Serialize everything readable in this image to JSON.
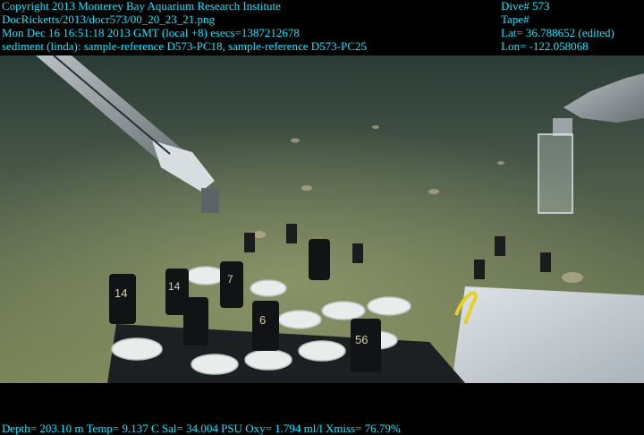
{
  "overlay": {
    "top_left": [
      "Copyright 2013 Monterey Bay Aquarium Research Institute",
      "DocRicketts/2013/docr573/00_20_23_21.png",
      "Mon Dec 16 16:51:18 2013 GMT (local +8)  esecs=1387212678",
      "sediment (linda): sample-reference D573-PC18, sample-reference D573-PC25"
    ],
    "top_right": [
      "Dive# 573",
      "Tape#",
      "Lat= 36.788652 (edited)",
      "Lon= -122.058068"
    ],
    "bottom": "Depth= 203.10 m  Temp= 9.137 C  Sal= 34.004 PSU  Oxy= 1.794 ml/l  Xmiss= 76.79%"
  },
  "scene": {
    "description_icons": [
      "robotic-arm-icon",
      "sediment-core-tube-icon"
    ],
    "tube_labels": [
      "14",
      "14",
      "7",
      "6",
      "56"
    ],
    "colors": {
      "overlay_text": "#19e6ff",
      "water": "#4a5a4a",
      "seafloor": "#7f8a5a",
      "tray": "#c9cfd4"
    }
  }
}
